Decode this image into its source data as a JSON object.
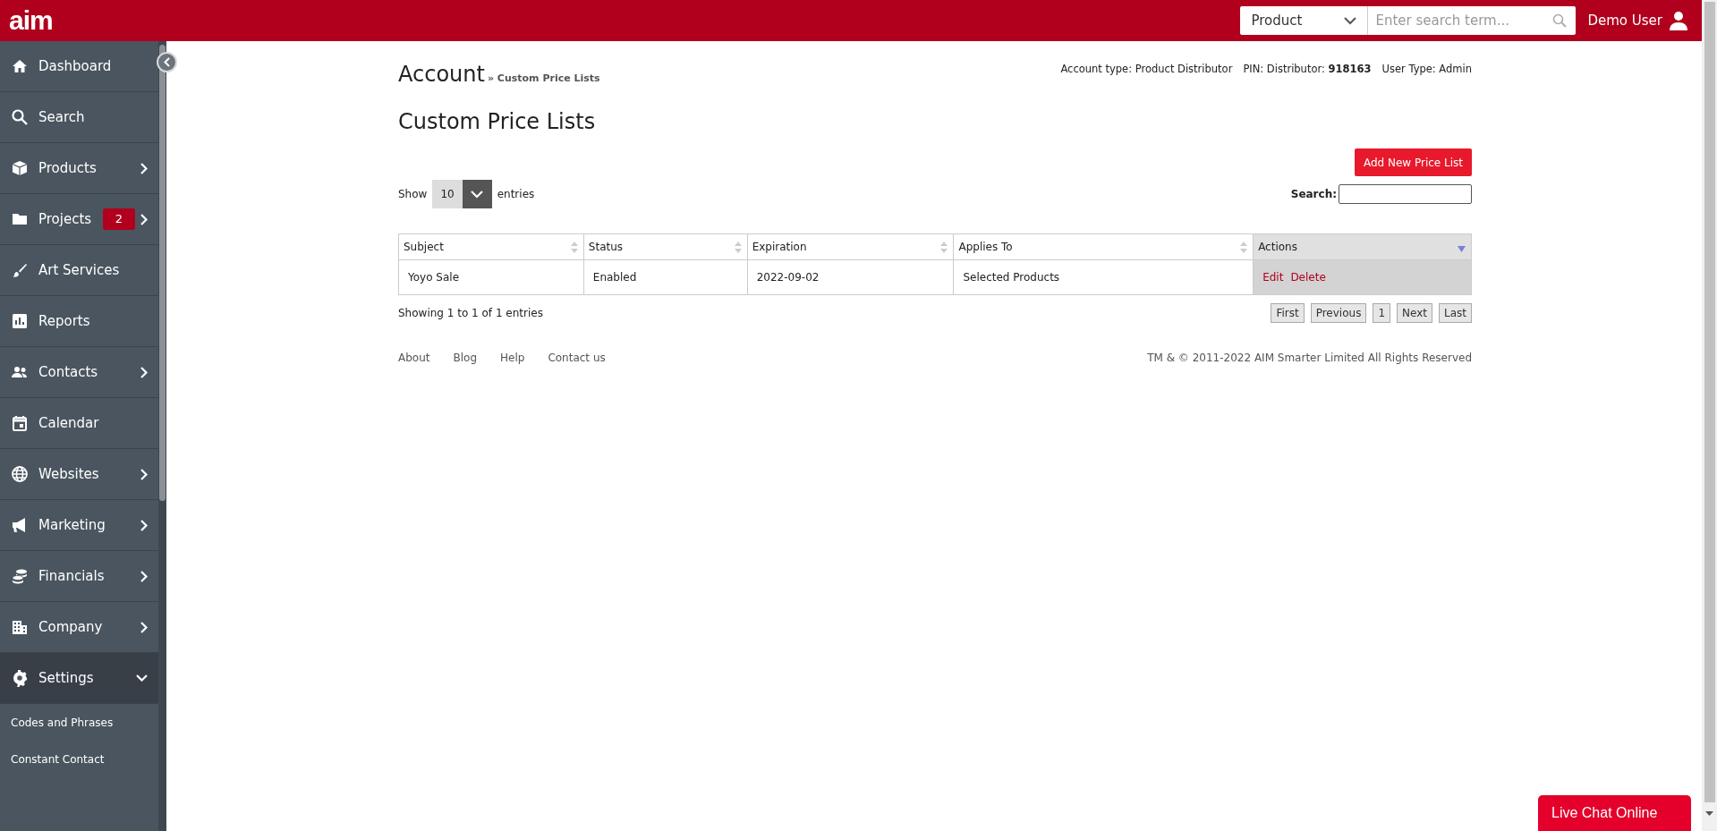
{
  "topbar": {
    "logo": "aim",
    "search_scope": "Product",
    "search": {
      "placeholder": "Enter search term..."
    },
    "user": "Demo User"
  },
  "sidebar": {
    "items": [
      {
        "label": "Dashboard",
        "submenu": false,
        "selected": false
      },
      {
        "label": "Search",
        "submenu": false,
        "selected": false
      },
      {
        "label": "Products",
        "submenu": true,
        "selected": false
      },
      {
        "label": "Projects",
        "submenu": true,
        "badge": "2",
        "selected": false
      },
      {
        "label": "Art Services",
        "submenu": false,
        "selected": false
      },
      {
        "label": "Reports",
        "submenu": false,
        "selected": false
      },
      {
        "label": "Contacts",
        "submenu": true,
        "selected": false
      },
      {
        "label": "Calendar",
        "submenu": false,
        "selected": false
      },
      {
        "label": "Websites",
        "submenu": true,
        "selected": false
      },
      {
        "label": "Marketing",
        "submenu": true,
        "selected": false
      },
      {
        "label": "Financials",
        "submenu": true,
        "selected": false
      },
      {
        "label": "Company",
        "submenu": true,
        "selected": false
      },
      {
        "label": "Settings",
        "submenu": true,
        "expanded": true,
        "selected": true,
        "children": [
          {
            "label": "Codes and Phrases"
          },
          {
            "label": "Constant Contact"
          }
        ]
      }
    ]
  },
  "breadcrumb": {
    "root": "Account",
    "current": "» Custom Price Lists"
  },
  "account_info": [
    {
      "label": "Account type:",
      "value": "Product Distributor"
    },
    {
      "label": "PIN:",
      "value": "Distributor: **918163**"
    },
    {
      "label": "User Type:",
      "value": "Admin"
    }
  ],
  "title": "Custom Price Lists",
  "add_button": "Add New Price List",
  "length": {
    "before": "Show",
    "value": "10",
    "after": "entries"
  },
  "filter": {
    "label": "Search:"
  },
  "table": {
    "columns": [
      {
        "label": "Subject",
        "selected": false
      },
      {
        "label": "Status",
        "selected": false
      },
      {
        "label": "Expiration",
        "selected": false
      },
      {
        "label": "Applies To",
        "selected": false
      },
      {
        "label": "Actions",
        "selected": true
      }
    ],
    "rows": [
      {
        "cells": [
          "Yoyo Sale",
          "Enabled",
          "2022-09-02",
          "Selected Products"
        ],
        "actions": [
          "Edit",
          "Delete"
        ]
      }
    ]
  },
  "info": "Showing 1 to 1 of 1 entries",
  "pagination": [
    {
      "label": "First"
    },
    {
      "label": "Previous"
    },
    {
      "label": "1"
    },
    {
      "label": "Next"
    },
    {
      "label": "Last"
    }
  ],
  "footer": {
    "links": [
      "About",
      "Blog",
      "Help",
      "Contact us"
    ],
    "copyright": "TM & © 2011-2022 AIM Smarter Limited All Rights Reserved"
  },
  "live_chat": "Live Chat Online"
}
